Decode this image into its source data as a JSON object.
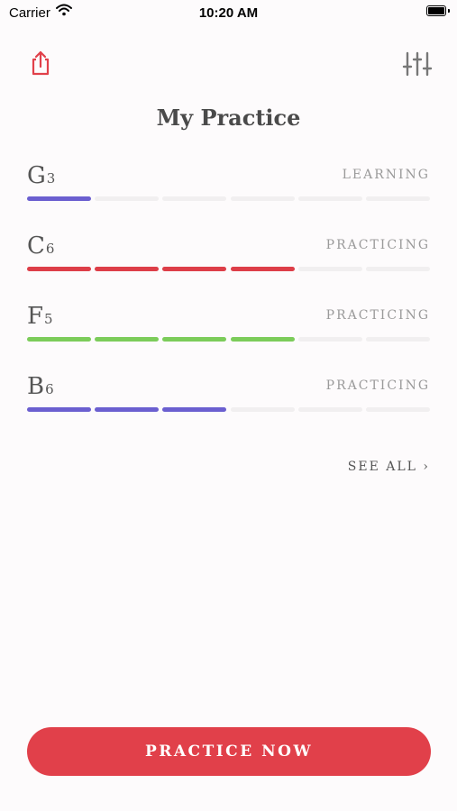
{
  "status_bar": {
    "carrier": "Carrier",
    "time": "10:20 AM",
    "icons": [
      "wifi-icon",
      "battery-icon"
    ]
  },
  "toolbar": {
    "share_icon": "share-icon",
    "filter_icon": "sliders-icon"
  },
  "title": "My Practice",
  "notes": [
    {
      "name": "G",
      "octave": "3",
      "status": "LEARNING",
      "progress_segments": 1,
      "total_segments": 6,
      "color": "#6b5fd0"
    },
    {
      "name": "C",
      "octave": "6",
      "status": "PRACTICING",
      "progress_segments": 4,
      "total_segments": 6,
      "color": "#dd3e48"
    },
    {
      "name": "F",
      "octave": "5",
      "status": "PRACTICING",
      "progress_segments": 4,
      "total_segments": 6,
      "color": "#7ccc5a"
    },
    {
      "name": "B",
      "octave": "6",
      "status": "PRACTICING",
      "progress_segments": 3,
      "total_segments": 6,
      "color": "#6b5fd0"
    }
  ],
  "see_all_label": "SEE ALL ›",
  "primary_button_label": "PRACTICE NOW",
  "colors": {
    "accent": "#e1404a",
    "empty_segment": "#f1eff0",
    "background": "#fdfbfc"
  }
}
